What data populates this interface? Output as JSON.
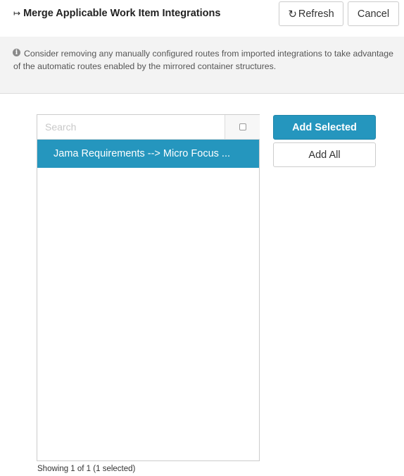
{
  "header": {
    "title": "Merge Applicable Work Item Integrations",
    "title_icon": "↦",
    "refresh_label": "Refresh",
    "refresh_icon": "↻",
    "cancel_label": "Cancel"
  },
  "notice": {
    "icon": "i",
    "text": "Consider removing any manually configured routes from imported integrations to take advantage of the automatic routes enabled by the mirrored container structures."
  },
  "list": {
    "search_placeholder": "Search",
    "select_all_checked": false,
    "items": [
      {
        "label": "Jama Requirements --> Micro Focus ...",
        "selected": true
      }
    ],
    "status": "Showing 1 of 1 (1 selected)"
  },
  "actions": {
    "add_selected_label": "Add Selected",
    "add_all_label": "Add All"
  },
  "colors": {
    "accent": "#2596be",
    "notice_bg": "#f3f3f3"
  }
}
